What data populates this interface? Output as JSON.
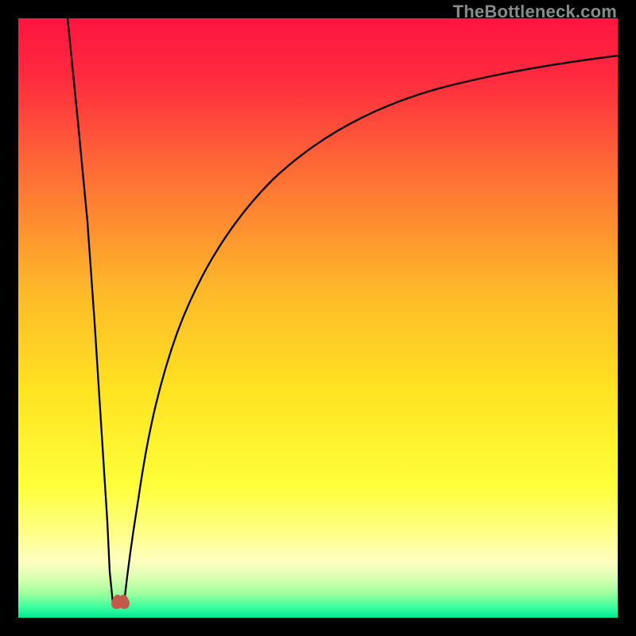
{
  "watermark": "TheBottleneck.com",
  "chart_data": {
    "type": "line",
    "title": "",
    "xlabel": "",
    "ylabel": "",
    "xlim": [
      0,
      1
    ],
    "ylim": [
      0,
      100
    ],
    "notes": "Bottleneck percentage curve with sharp minimum near x≈0.16. Background is a vertical heat gradient from red (top, high bottleneck) through orange/yellow to green (bottom, low bottleneck). Two branches: steep left branch descends from top-left to the minimum, right branch rises asymptotically toward the top-right.",
    "series": [
      {
        "name": "left-branch",
        "points": [
          {
            "x": 0.083,
            "y": 100
          },
          {
            "x": 0.1,
            "y": 83
          },
          {
            "x": 0.115,
            "y": 66
          },
          {
            "x": 0.128,
            "y": 49
          },
          {
            "x": 0.138,
            "y": 33
          },
          {
            "x": 0.148,
            "y": 16
          },
          {
            "x": 0.153,
            "y": 8
          },
          {
            "x": 0.158,
            "y": 2.5
          }
        ]
      },
      {
        "name": "right-branch",
        "points": [
          {
            "x": 0.177,
            "y": 2.5
          },
          {
            "x": 0.185,
            "y": 8
          },
          {
            "x": 0.2,
            "y": 20
          },
          {
            "x": 0.225,
            "y": 35
          },
          {
            "x": 0.26,
            "y": 50
          },
          {
            "x": 0.31,
            "y": 62
          },
          {
            "x": 0.38,
            "y": 72
          },
          {
            "x": 0.47,
            "y": 80
          },
          {
            "x": 0.58,
            "y": 85.5
          },
          {
            "x": 0.7,
            "y": 89
          },
          {
            "x": 0.83,
            "y": 91.5
          },
          {
            "x": 1.0,
            "y": 93.7
          }
        ]
      }
    ],
    "minimum_marker": {
      "x": 0.167,
      "y": 1.5,
      "color": "#c15a4a",
      "shape": "rounded-double-lobe"
    },
    "gradient_stops": [
      {
        "pos": 0.0,
        "color": "#ff1440"
      },
      {
        "pos": 0.1,
        "color": "#ff2b3f"
      },
      {
        "pos": 0.25,
        "color": "#ff6a36"
      },
      {
        "pos": 0.45,
        "color": "#ffb72a"
      },
      {
        "pos": 0.62,
        "color": "#ffe321"
      },
      {
        "pos": 0.78,
        "color": "#ffff3a"
      },
      {
        "pos": 0.86,
        "color": "#ffff8a"
      },
      {
        "pos": 0.905,
        "color": "#ffffc0"
      },
      {
        "pos": 0.935,
        "color": "#d8ffb0"
      },
      {
        "pos": 0.96,
        "color": "#9cff9c"
      },
      {
        "pos": 0.982,
        "color": "#3effa0"
      },
      {
        "pos": 1.0,
        "color": "#00e890"
      }
    ]
  }
}
